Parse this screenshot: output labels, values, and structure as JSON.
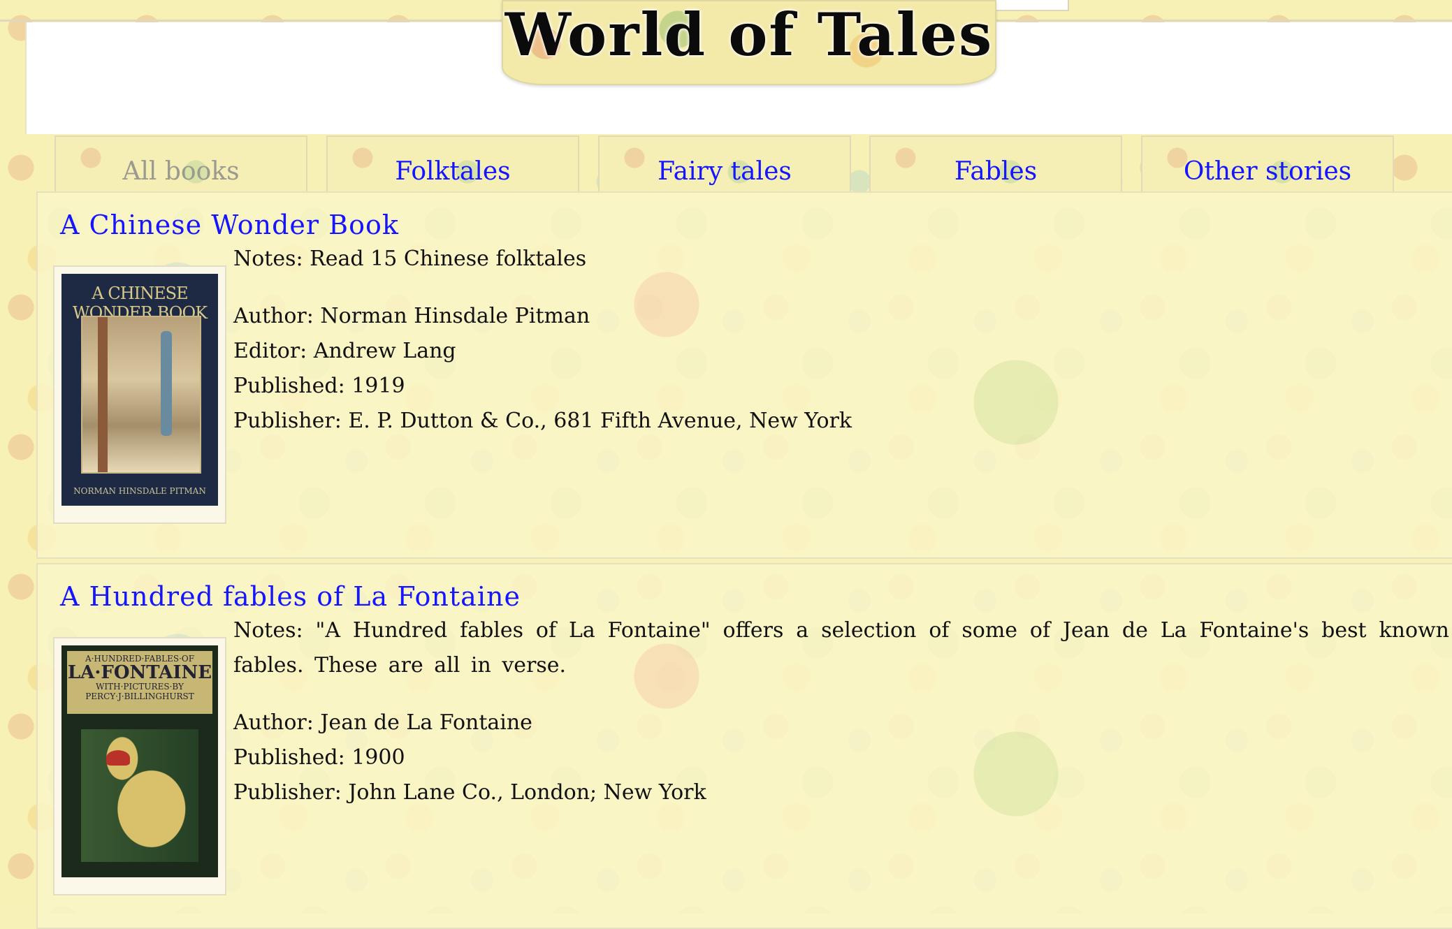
{
  "site": {
    "title": "World of Tales"
  },
  "tabs": [
    {
      "label": "All books",
      "active": true
    },
    {
      "label": "Folktales",
      "active": false
    },
    {
      "label": "Fairy tales",
      "active": false
    },
    {
      "label": "Fables",
      "active": false
    },
    {
      "label": "Other stories",
      "active": false
    }
  ],
  "books": [
    {
      "title": "A Chinese Wonder Book",
      "cover_text": "A CHINESE WONDER BOOK",
      "cover_footer": "NORMAN HINSDALE PITMAN",
      "notes": "Notes: Read 15 Chinese folktales",
      "author": "Author: Norman Hinsdale Pitman",
      "editor": "Editor: Andrew Lang",
      "published": "Published: 1919",
      "publisher": "Publisher: E. P. Dutton & Co., 681 Fifth Avenue, New York"
    },
    {
      "title": "A Hundred fables of La Fontaine",
      "cover_line1": "A·HUNDRED·FABLES·OF",
      "cover_line2": "LA·FONTAINE",
      "cover_line3": "WITH·PICTURES·BY PERCY·J·BILLINGHURST",
      "notes": "Notes: \"A Hundred fables of La Fontaine\" offers a selection of some of Jean de La Fontaine's best known fables. These are all in verse.",
      "author": "Author: Jean de La Fontaine",
      "published": "Published: 1900",
      "publisher": "Publisher: John Lane Co., London; New York"
    }
  ],
  "colors": {
    "link": "#1515ff",
    "tab_active": "#9a9a90"
  }
}
